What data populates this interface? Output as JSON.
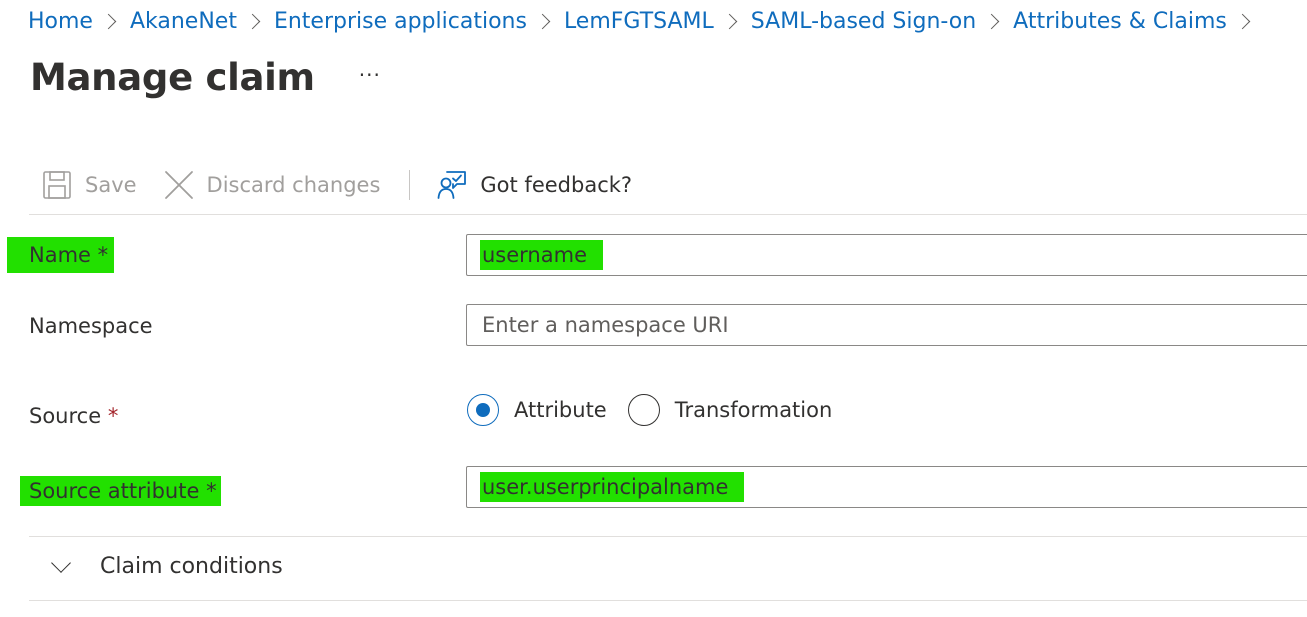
{
  "breadcrumb": [
    {
      "label": "Home"
    },
    {
      "label": "AkaneNet"
    },
    {
      "label": "Enterprise applications"
    },
    {
      "label": "LemFGTSAML"
    },
    {
      "label": "SAML-based Sign-on"
    },
    {
      "label": "Attributes & Claims"
    }
  ],
  "header": {
    "title": "Manage claim",
    "more_label": "···"
  },
  "toolbar": {
    "save_label": "Save",
    "save_icon": "save-icon",
    "discard_label": "Discard changes",
    "discard_icon": "close-icon",
    "feedback_label": "Got feedback?",
    "feedback_icon": "feedback-icon"
  },
  "form": {
    "name": {
      "label": "Name",
      "required": "*",
      "value": "username"
    },
    "namespace": {
      "label": "Namespace",
      "placeholder": "Enter a namespace URI",
      "value": ""
    },
    "source": {
      "label": "Source",
      "required": "*",
      "options": [
        {
          "label": "Attribute",
          "selected": true
        },
        {
          "label": "Transformation",
          "selected": false
        }
      ]
    },
    "source_attribute": {
      "label": "Source attribute",
      "required": "*",
      "value": "user.userprincipalname"
    }
  },
  "sections": {
    "claim_conditions": {
      "label": "Claim conditions",
      "expanded": false
    }
  },
  "colors": {
    "link": "#0f6cbd",
    "highlight": "#22e000",
    "required": "#a4262c",
    "disabled": "#a19f9d"
  }
}
